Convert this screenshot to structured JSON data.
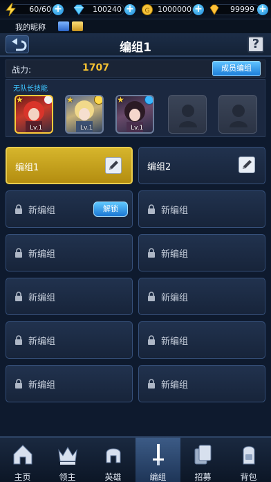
{
  "resources": {
    "energy": {
      "value": "60/60",
      "icon": "lightning-icon"
    },
    "diamond": {
      "value": "100240",
      "icon": "diamond-icon"
    },
    "gold": {
      "value": "1000000",
      "icon": "gold-coin-icon"
    },
    "gem": {
      "value": "99999",
      "icon": "gem-icon"
    }
  },
  "profile": {
    "nickname": "我的昵称"
  },
  "header": {
    "title": "编组1"
  },
  "power": {
    "label": "战力:",
    "value": "1707",
    "member_button": "成员编组"
  },
  "heroes": {
    "no_leader_skill": "无队长技能",
    "slots": [
      {
        "level": "Lv.1"
      },
      {
        "level": "Lv.1"
      },
      {
        "level": "Lv.1"
      }
    ]
  },
  "groups": [
    {
      "name": "编组1"
    },
    {
      "name": "编组2"
    },
    {
      "name": "新编组",
      "action": "解锁"
    },
    {
      "name": "新编组"
    },
    {
      "name": "新编组"
    },
    {
      "name": "新编组"
    },
    {
      "name": "新编组"
    },
    {
      "name": "新编组"
    },
    {
      "name": "新编组"
    },
    {
      "name": "新编组"
    },
    {
      "name": "新编组"
    },
    {
      "name": "新编组"
    }
  ],
  "nav": [
    {
      "label": "主页"
    },
    {
      "label": "领主"
    },
    {
      "label": "英雄"
    },
    {
      "label": "编组"
    },
    {
      "label": "招募"
    },
    {
      "label": "背包"
    }
  ],
  "colors": {
    "accent": "#f2c032",
    "button_blue": "#1d7ed8",
    "active_group": "#c9a51f"
  }
}
